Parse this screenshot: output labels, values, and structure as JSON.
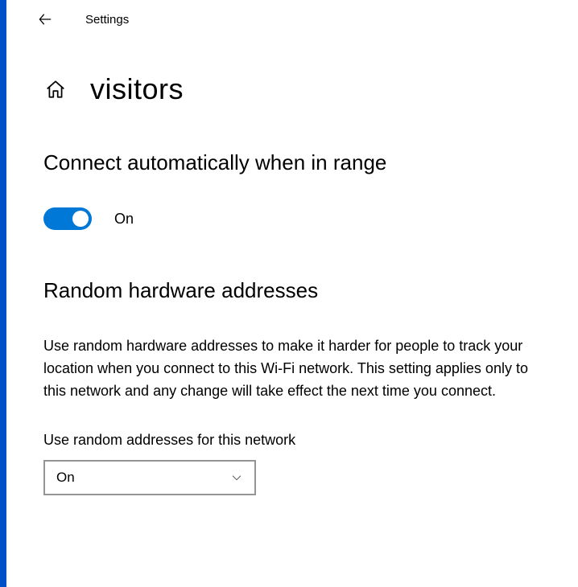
{
  "app_title": "Settings",
  "page_title": "visitors",
  "sections": {
    "connect": {
      "heading": "Connect automatically when in range",
      "toggle_state": "On"
    },
    "random": {
      "heading": "Random hardware addresses",
      "description": "Use random hardware addresses to make it harder for people to track your location when you connect to this Wi-Fi network. This setting applies only to this network and any change will take effect the next time you connect.",
      "dropdown_label": "Use random addresses for this network",
      "dropdown_value": "On"
    }
  },
  "colors": {
    "accent": "#0078d7",
    "window_border": "#0050c8"
  }
}
